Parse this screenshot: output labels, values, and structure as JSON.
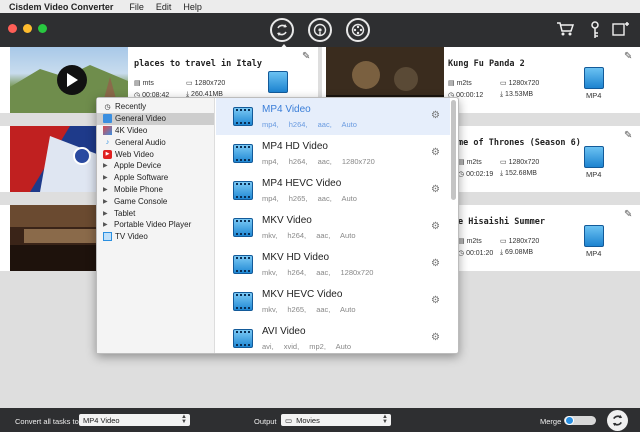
{
  "menubar": {
    "app_name": "Cisdem Video Converter",
    "items": [
      "File",
      "Edit",
      "Help"
    ]
  },
  "toolbar": {
    "traffic_colors": [
      "#fe5f57",
      "#febc2e",
      "#28c840"
    ]
  },
  "cards": [
    {
      "title": "places to travel in Italy",
      "format": "mts",
      "duration": "00:08:42",
      "resolution": "1280x720",
      "size": "260.41MB",
      "output": ""
    },
    {
      "title": "Kung Fu Panda 2",
      "format": "m2ts",
      "duration": "00:00:12",
      "resolution": "1280x720",
      "size": "13.53MB",
      "output": "MP4"
    },
    {
      "title": "",
      "format": "",
      "duration": "",
      "resolution": "",
      "size": "",
      "output": ""
    },
    {
      "title": "me of Thrones (Season 6)",
      "format": "m2ts",
      "duration": "00:02:19",
      "resolution": "1280x720",
      "size": "152.68MB",
      "output": "MP4"
    },
    {
      "title": "",
      "format": "",
      "duration": "",
      "resolution": "",
      "size": "",
      "output": ""
    },
    {
      "title": "e Hisaishi  Summer",
      "format": "m2ts",
      "duration": "00:01:20",
      "resolution": "1280x720",
      "size": "69.08MB",
      "output": "MP4"
    }
  ],
  "categories": [
    {
      "label": "Recently",
      "icon": "clock-icon"
    },
    {
      "label": "General Video",
      "icon": "film-icon",
      "selected": true
    },
    {
      "label": "4K Video",
      "icon": "4k-icon"
    },
    {
      "label": "General Audio",
      "icon": "music-note-icon"
    },
    {
      "label": "Web Video",
      "icon": "youtube-icon"
    },
    {
      "label": "Apple Device",
      "icon": "disclosure-arrow-icon"
    },
    {
      "label": "Apple Software",
      "icon": "disclosure-arrow-icon"
    },
    {
      "label": "Mobile Phone",
      "icon": "disclosure-arrow-icon"
    },
    {
      "label": "Game Console",
      "icon": "disclosure-arrow-icon"
    },
    {
      "label": "Tablet",
      "icon": "disclosure-arrow-icon"
    },
    {
      "label": "Portable Video Player",
      "icon": "disclosure-arrow-icon"
    },
    {
      "label": "TV Video",
      "icon": "tv-icon"
    }
  ],
  "presets": [
    {
      "name": "MP4 Video",
      "details": "mp4,  h264,  aac,  Auto",
      "selected": true
    },
    {
      "name": "MP4 HD Video",
      "details": "mp4,  h264,  aac,  1280x720"
    },
    {
      "name": "MP4 HEVC Video",
      "details": "mp4,  h265,  aac,  Auto"
    },
    {
      "name": "MKV Video",
      "details": "mkv,  h264,  aac,  Auto"
    },
    {
      "name": "MKV HD Video",
      "details": "mkv,  h264,  aac,  1280x720"
    },
    {
      "name": "MKV HEVC Video",
      "details": "mkv,  h265,  aac,  Auto"
    },
    {
      "name": "AVI Video",
      "details": "avi,  xvid,  mp2,  Auto"
    }
  ],
  "bottombar": {
    "convert_all_label": "Convert all tasks to",
    "convert_all_value": "MP4 Video",
    "output_label": "Output",
    "output_value": "Movies",
    "merge_label": "Merge"
  }
}
